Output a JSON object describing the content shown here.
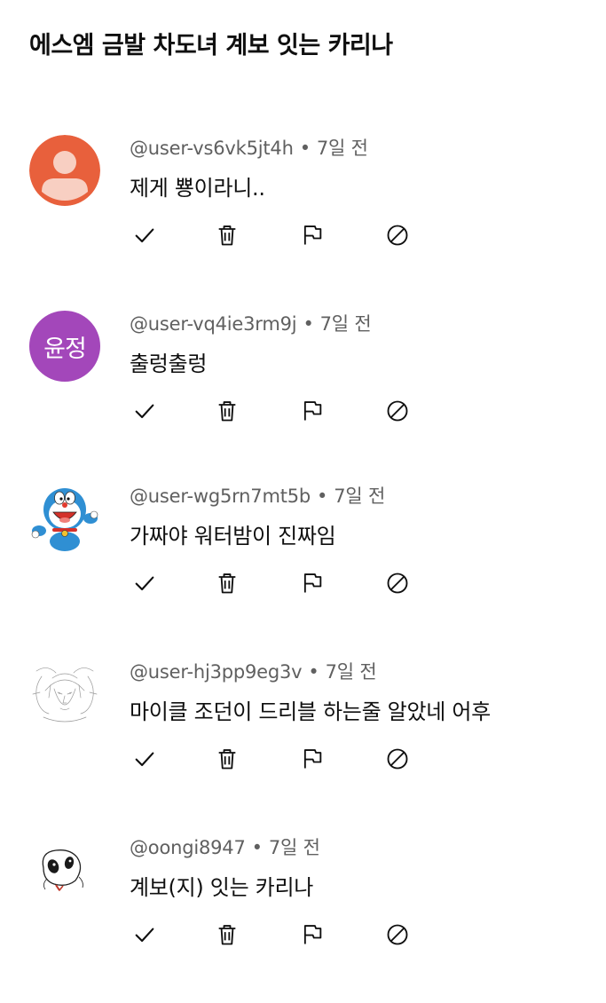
{
  "header": {
    "title": "에스엠 금발 차도녀 계보 잇는 카리나"
  },
  "comments": [
    {
      "author": "@user-vs6vk5jt4h",
      "time": "7일 전",
      "text": "제게 뿅이라니..",
      "avatar_type": "default-person",
      "avatar_bg": "#e8603c"
    },
    {
      "author": "@user-vq4ie3rm9j",
      "time": "7일 전",
      "text": "출렁출렁",
      "avatar_type": "initials",
      "avatar_initials": "윤정",
      "avatar_bg": "#a347ba"
    },
    {
      "author": "@user-wg5rn7mt5b",
      "time": "7일 전",
      "text": "가짜야 워터밤이 진짜임",
      "avatar_type": "cartoon-cat-drawing",
      "avatar_bg": "#ffffff"
    },
    {
      "author": "@user-hj3pp9eg3v",
      "time": "7일 전",
      "text": "마이클 조던이 드리블 하는줄 알았네 어후",
      "avatar_type": "sketch-face-drawing",
      "avatar_bg": "#ffffff"
    },
    {
      "author": "@oongi8947",
      "time": "7일 전",
      "text": "계보(지) 잇는 카리나",
      "avatar_type": "doodle-face-drawing",
      "avatar_bg": "#ffffff"
    }
  ],
  "actions": [
    {
      "name": "approve",
      "icon": "check-icon"
    },
    {
      "name": "delete",
      "icon": "trash-icon"
    },
    {
      "name": "report",
      "icon": "flag-icon"
    },
    {
      "name": "block",
      "icon": "block-icon"
    }
  ]
}
